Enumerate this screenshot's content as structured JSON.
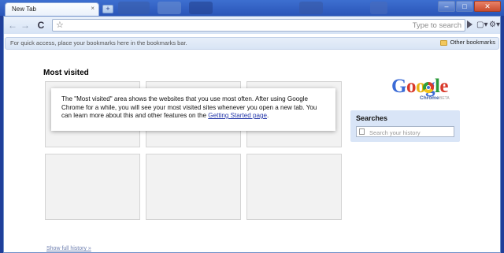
{
  "window": {
    "tab_title": "New Tab",
    "tab_close": "×",
    "new_tab": "+",
    "minimize": "–",
    "maximize": "□",
    "close": "✕"
  },
  "toolbar": {
    "back": "←",
    "forward": "→",
    "reload": "C",
    "star": "☆",
    "address_value": "",
    "search_hint": "Type to search",
    "go": "▶",
    "page_menu": "▢▾",
    "tools_menu": "⚙▾"
  },
  "bookmarks_bar": {
    "hint": "For quick access, place your bookmarks here in the bookmarks bar.",
    "other_bookmarks": "Other bookmarks"
  },
  "most_visited": {
    "title": "Most visited",
    "tip_text": "The \"Most visited\" area shows the websites that you use most often. After using Google Chrome for a while, you will see your most visited sites whenever you open a new tab. You can learn more about this and other features on the ",
    "tip_link": "Getting Started page",
    "tip_end": ".",
    "show_history": "Show full history »"
  },
  "logo": {
    "google_letters": [
      {
        "ch": "G",
        "color": "#3b6bd6"
      },
      {
        "ch": "o",
        "color": "#d93a2b"
      },
      {
        "ch": "o",
        "color": "#e8b414"
      },
      {
        "ch": "g",
        "color": "#3b6bd6"
      },
      {
        "ch": "l",
        "color": "#2b9a3a"
      },
      {
        "ch": "e",
        "color": "#d93a2b"
      }
    ],
    "chrome": "Chrome",
    "beta": "BETA"
  },
  "searches": {
    "title": "Searches",
    "placeholder": "Search your history"
  },
  "colors": {
    "desktop": "#1f3f9a",
    "link": "#2336a8",
    "searches_bg": "#d9e5f7"
  }
}
